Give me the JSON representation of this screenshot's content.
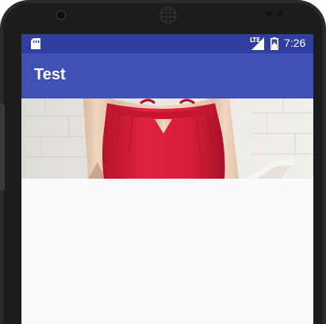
{
  "status_bar": {
    "time": "7:26",
    "network_label": "LTE",
    "icons": [
      "sim-card-icon",
      "signal-icon",
      "battery-icon"
    ]
  },
  "app_bar": {
    "title": "Test"
  },
  "banner": {
    "image": "woman-in-red-halter-top-photo"
  },
  "colors": {
    "status_bar": "#303f9f",
    "app_bar": "#3f51b5",
    "background": "#fafafa",
    "top_color": "#d81e3a"
  }
}
